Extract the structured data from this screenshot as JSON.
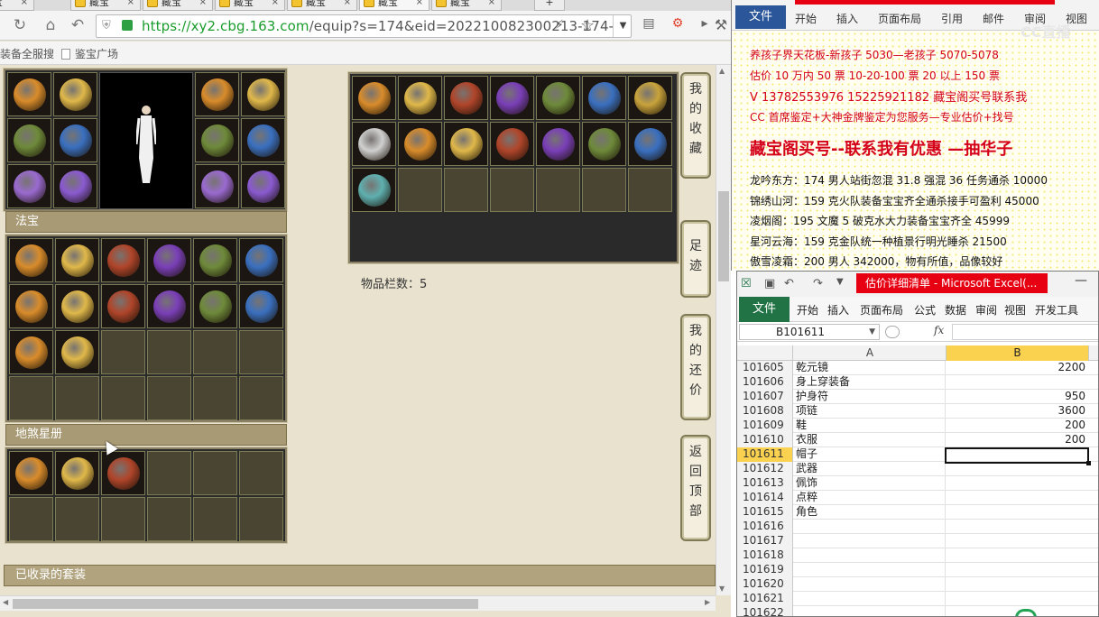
{
  "browser": {
    "tabs": [
      "置宝",
      "藏宝",
      "藏宝",
      "藏宝",
      "藏宝",
      "藏宝",
      "藏宝"
    ],
    "new_tab": "+",
    "url_scheme": "https://",
    "url_domain": "xy2.cbg.163.com",
    "url_path": "/equip?s=174&eid=202210082300213-174-",
    "bookmarks": [
      "装备全服搜",
      "鉴宝广场"
    ]
  },
  "game": {
    "fabao_title": "法宝",
    "disha_title": "地煞星册",
    "slot_count": "物品栏数：5",
    "collected_title": "已收录的套装",
    "side_buttons": [
      "我的收藏",
      "足迹",
      "我的还价",
      "返回顶部"
    ]
  },
  "word": {
    "tabs": [
      "文件",
      "开始",
      "插入",
      "页面布局",
      "引用",
      "邮件",
      "审阅",
      "视图"
    ],
    "watermark": "CC直播",
    "lines": [
      {
        "text": "养孩子界天花板-新孩子 5030—老孩子 5070-5078",
        "style": "red"
      },
      {
        "text": "估价 10 万内 50 票    10-20-100 票       20 以上 150 票",
        "style": "red"
      },
      {
        "text": "V 13782553976    15225921182  藏宝阁买号联系我",
        "style": "big2"
      },
      {
        "text": "CC 首席鉴定+大神金牌鉴定为您服务—专业估价+找号",
        "style": "red"
      },
      {
        "text": "藏宝阁买号--联系我有优惠 —抽华子",
        "style": "big"
      },
      {
        "text": "龙吟东方：174 男人站街忽混 31.8 强混 36 任务通杀 10000",
        "style": "black"
      },
      {
        "text": "锦绣山河：159 克火队装备宝宝齐全通杀接手可盈利 45000",
        "style": "black"
      },
      {
        "text": "凌烟阁：195 文魔 5 破克水大力装备宝宝齐全 45999",
        "style": "black"
      },
      {
        "text": "星河云海：159 克金队统一种植景行明光睡杀 21500",
        "style": "black"
      },
      {
        "text": "傲雪凌霜：200 男人 342000，物有所值，品像较好",
        "style": "black"
      }
    ]
  },
  "excel": {
    "title": "估价详细清单 - Microsoft Excel(...",
    "file_label": "文件",
    "tabs": [
      "开始",
      "插入",
      "页面布局",
      "公式",
      "数据",
      "审阅",
      "视图",
      "开发工具"
    ],
    "name_box": "B101611",
    "fx": "fx",
    "columns": [
      "A",
      "B"
    ],
    "selected_row": "101611",
    "rows": [
      {
        "n": "101605",
        "a": "乾元镜",
        "b": "2200"
      },
      {
        "n": "101606",
        "a": "身上穿装备",
        "b": ""
      },
      {
        "n": "101607",
        "a": "护身符",
        "b": "950"
      },
      {
        "n": "101608",
        "a": "项链",
        "b": "3600"
      },
      {
        "n": "101609",
        "a": "鞋",
        "b": "200"
      },
      {
        "n": "101610",
        "a": "衣服",
        "b": "200"
      },
      {
        "n": "101611",
        "a": "帽子",
        "b": ""
      },
      {
        "n": "101612",
        "a": "武器",
        "b": ""
      },
      {
        "n": "101613",
        "a": "佩饰",
        "b": ""
      },
      {
        "n": "101614",
        "a": "点粹",
        "b": ""
      },
      {
        "n": "101615",
        "a": "角色",
        "b": ""
      },
      {
        "n": "101616",
        "a": "",
        "b": ""
      },
      {
        "n": "101617",
        "a": "",
        "b": ""
      },
      {
        "n": "101618",
        "a": "",
        "b": ""
      },
      {
        "n": "101619",
        "a": "",
        "b": ""
      },
      {
        "n": "101620",
        "a": "",
        "b": ""
      },
      {
        "n": "101621",
        "a": "",
        "b": ""
      },
      {
        "n": "101622",
        "a": "",
        "b": ""
      }
    ]
  }
}
